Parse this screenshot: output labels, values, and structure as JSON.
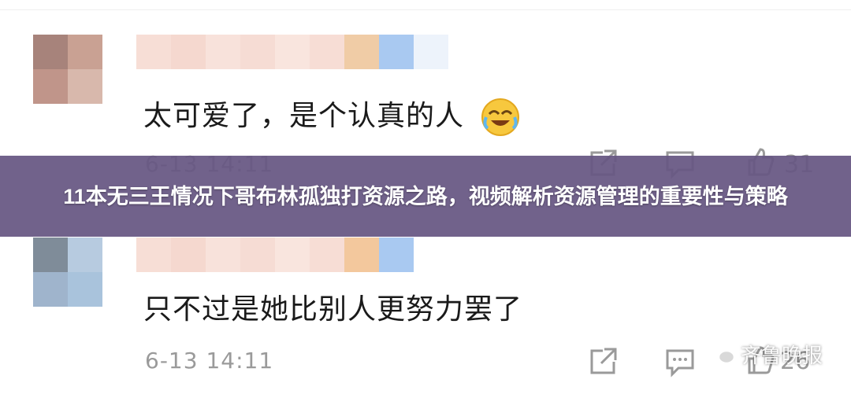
{
  "banner": {
    "title": "11本无三王情况下哥布林孤独打资源之路，视频解析资源管理的重要性与策略"
  },
  "comments": [
    {
      "text": "太可爱了，是个认真的人",
      "emoji_icon": "laughing-tears-emoji-icon",
      "time": "6-13 14:11",
      "like_count": "31"
    },
    {
      "text": "只不过是她比别人更努力罢了",
      "time": "6-13 14:11",
      "like_count": "26"
    }
  ],
  "watermark": {
    "text": "齐鲁晚报",
    "icon": "wechat-icon"
  },
  "colors": {
    "banner_background": "#665682",
    "banner_text": "#ffffff",
    "meta_text": "#9a9a9a",
    "comment_text": "#1a1a1a"
  }
}
